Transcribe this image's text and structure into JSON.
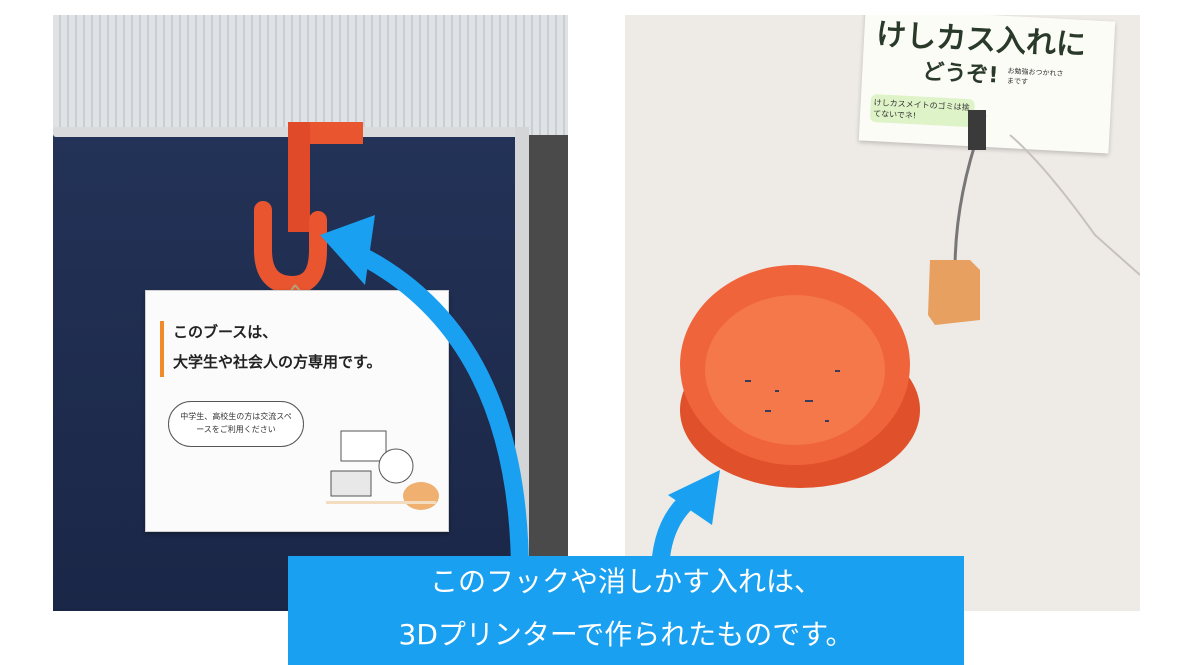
{
  "sign": {
    "title_line1": "このブースは、",
    "title_line2": "大学生や社会人の方専用です。",
    "bubble_text": "中学生、高校生の方は交流スペースをご利用ください"
  },
  "card": {
    "main_text": "けしカス入れに",
    "main_text2": "どうぞ!",
    "sub_text": "けしカスメイトのゴミは捨てないでネ!",
    "sub_text2": "お勉強おつかれさまです"
  },
  "caption": {
    "line1": "このフックや消しかす入れは、",
    "line2": "3Dプリンターで作られたものです。"
  },
  "colors": {
    "caption_bg": "#1aa0f0",
    "arrow": "#1aa0f0",
    "printed_object": "#f0643c"
  }
}
